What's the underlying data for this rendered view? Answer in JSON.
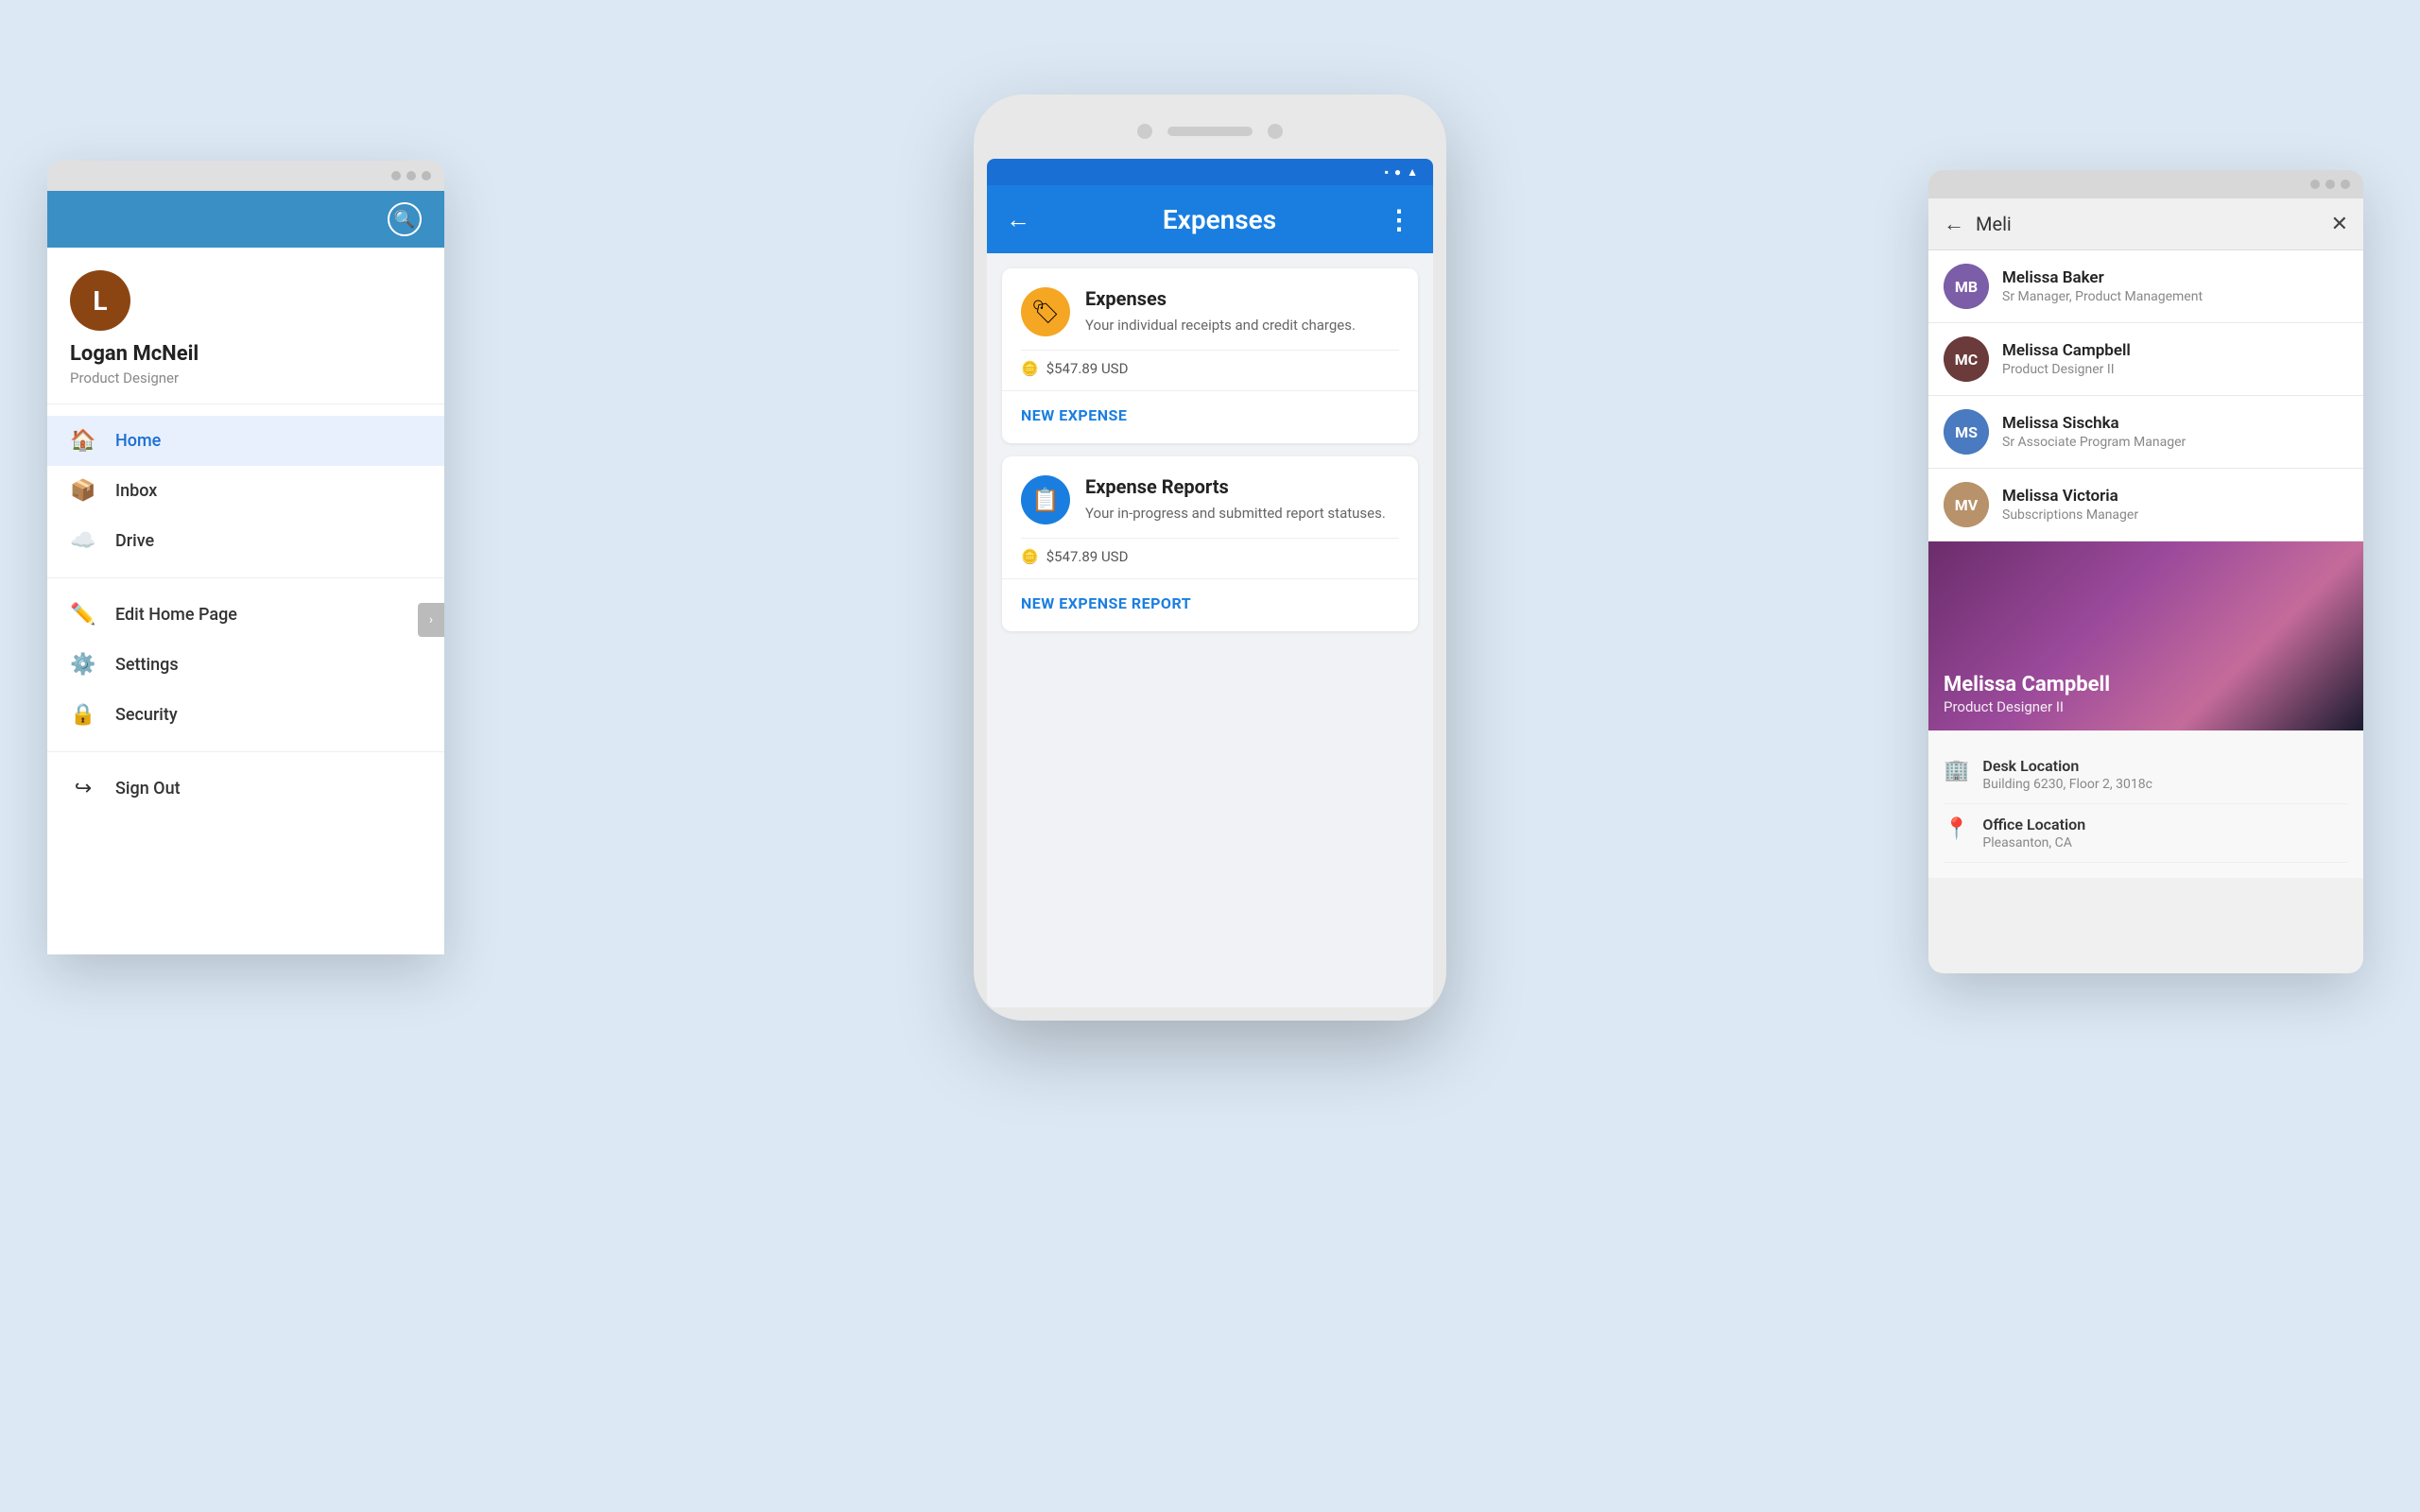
{
  "left_panel": {
    "user": {
      "name": "Logan McNeil",
      "role": "Product Designer",
      "avatar_initials": "L"
    },
    "nav_items": [
      {
        "id": "home",
        "label": "Home",
        "icon": "🏠",
        "active": true
      },
      {
        "id": "inbox",
        "label": "Inbox",
        "icon": "📦",
        "active": false
      },
      {
        "id": "drive",
        "label": "Drive",
        "icon": "☁️",
        "active": false
      }
    ],
    "secondary_items": [
      {
        "id": "edit-home",
        "label": "Edit Home Page",
        "icon": "✏️"
      },
      {
        "id": "settings",
        "label": "Settings",
        "icon": "⚙️"
      },
      {
        "id": "security",
        "label": "Security",
        "icon": "🔒"
      }
    ],
    "sign_out": {
      "label": "Sign Out",
      "icon": "↪"
    }
  },
  "center_panel": {
    "toolbar": {
      "title": "Expenses",
      "back_label": "←",
      "more_label": "⋮"
    },
    "cards": [
      {
        "id": "expenses",
        "title": "Expenses",
        "description": "Your individual receipts and credit charges.",
        "amount": "$547.89 USD",
        "action_label": "NEW EXPENSE",
        "icon_color": "orange",
        "icon": "🏷"
      },
      {
        "id": "expense-reports",
        "title": "Expense Reports",
        "description": "Your in-progress and submitted report statuses.",
        "amount": "$547.89 USD",
        "action_label": "NEW EXPENSE REPORT",
        "icon_color": "blue",
        "icon": "📋"
      }
    ]
  },
  "right_panel": {
    "search_query": "Meli",
    "results": [
      {
        "id": "melissa-baker",
        "name": "Melissa Baker",
        "title": "Sr Manager, Product Management",
        "avatar_color": "#7b5ea7",
        "avatar_initials": "MB"
      },
      {
        "id": "melissa-campbell",
        "name": "Melissa Campbell",
        "title": "Product Designer II",
        "avatar_color": "#6b3a3a",
        "avatar_initials": "MC"
      },
      {
        "id": "melissa-sischka",
        "name": "Melissa Sischka",
        "title": "Sr Associate Program Manager",
        "avatar_color": "#4a7abf",
        "avatar_initials": "MS"
      },
      {
        "id": "melissa-victoria",
        "name": "Melissa Victoria",
        "title": "Subscriptions Manager",
        "avatar_color": "#b8926a",
        "avatar_initials": "MV"
      }
    ],
    "profile": {
      "name": "Melissa Campbell",
      "title": "Product Designer II",
      "desk_location_label": "Desk Location",
      "desk_location_value": "Building 6230, Floor 2, 3018c",
      "office_location_label": "Office Location",
      "office_location_value": "Pleasanton, CA"
    }
  }
}
